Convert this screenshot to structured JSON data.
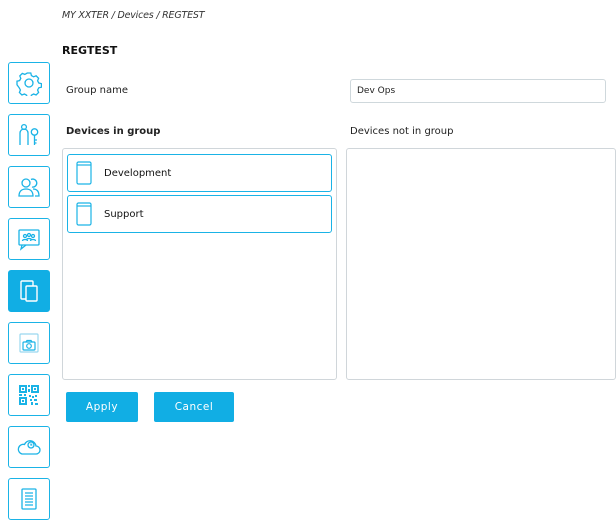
{
  "breadcrumb": {
    "text": "MY XXTER  / Devices  / REGTEST"
  },
  "page": {
    "title": "REGTEST"
  },
  "sidebar": {
    "items": [
      {
        "icon": "gear-icon"
      },
      {
        "icon": "person-key-icon"
      },
      {
        "icon": "users-icon"
      },
      {
        "icon": "group-chat-icon"
      },
      {
        "icon": "devices-icon",
        "active": true
      },
      {
        "icon": "camera-frame-icon"
      },
      {
        "icon": "qr-code-icon"
      },
      {
        "icon": "cloud-icon"
      },
      {
        "icon": "document-icon"
      }
    ]
  },
  "form": {
    "group_name_label": "Group name",
    "group_name_value": "Dev Ops",
    "devices_in_group_label": "Devices in group",
    "devices_not_in_group_label": "Devices not in group"
  },
  "devices_in_group": [
    {
      "label": "Development"
    },
    {
      "label": "Support"
    }
  ],
  "devices_not_in_group": [],
  "actions": {
    "apply_label": "Apply",
    "cancel_label": "Cancel"
  },
  "colors": {
    "accent": "#11aee4",
    "border": "#1ab3e6",
    "list_border": "#d0d6da"
  }
}
